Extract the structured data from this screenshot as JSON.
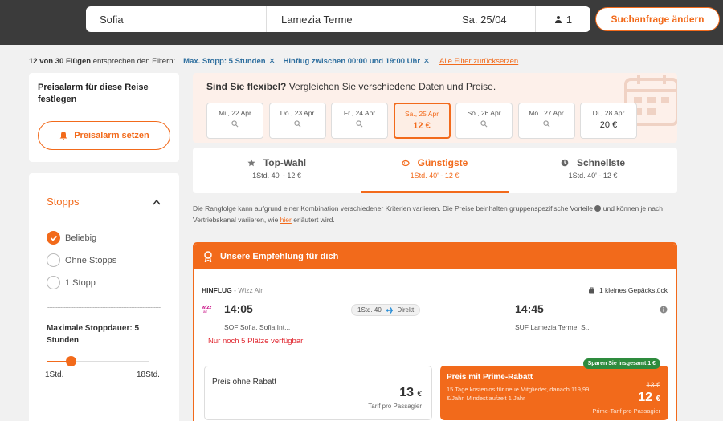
{
  "search": {
    "origin": "Sofia",
    "destination": "Lamezia Terme",
    "date": "Sa. 25/04",
    "passengers": "1",
    "change_label": "Suchanfrage ändern"
  },
  "filters": {
    "count_bold": "12 von 30 Flügen",
    "count_rest": " entsprechen den Filtern:",
    "chips": [
      "Max. Stopp: 5 Stunden",
      "Hinflug zwischen 00:00 und 19:00 Uhr"
    ],
    "chip_close": "✕",
    "reset_label": "Alle Filter zurücksetzen"
  },
  "alarm": {
    "title": "Preisalarm für diese Reise festlegen",
    "button": "Preisalarm setzen"
  },
  "stops": {
    "heading": "Stopps",
    "options": [
      {
        "label": "Beliebig",
        "checked": true
      },
      {
        "label": "Ohne Stopps",
        "checked": false
      },
      {
        "label": "1 Stopp",
        "checked": false
      }
    ],
    "max_duration_label": "Maximale Stoppdauer: 5 Stunden",
    "slider_min": "1Std.",
    "slider_max": "18Std.",
    "slider_value_fraction": 0.24
  },
  "flex": {
    "title_bold": "Sind Sie flexibel?",
    "title_rest": " Vergleichen Sie verschiedene Daten und Preise.",
    "dates": [
      {
        "label": "Mi., 22 Apr",
        "price": "",
        "selected": false
      },
      {
        "label": "Do., 23 Apr",
        "price": "",
        "selected": false
      },
      {
        "label": "Fr., 24 Apr",
        "price": "",
        "selected": false
      },
      {
        "label": "Sa., 25 Apr",
        "price": "12 €",
        "selected": true
      },
      {
        "label": "So., 26 Apr",
        "price": "",
        "selected": false
      },
      {
        "label": "Mo., 27 Apr",
        "price": "",
        "selected": false
      },
      {
        "label": "Di., 28 Apr",
        "price": "20 €",
        "selected": false
      }
    ]
  },
  "sort": {
    "tabs": [
      {
        "label": "Top-Wahl",
        "sub": "1Std. 40' - 12 €",
        "icon": "star-icon",
        "active": false
      },
      {
        "label": "Günstigste",
        "sub": "1Std. 40' - 12 €",
        "icon": "piggy-bank-icon",
        "active": true
      },
      {
        "label": "Schnellste",
        "sub": "1Std. 40' - 12 €",
        "icon": "clock-icon",
        "active": false
      }
    ]
  },
  "disclaimer": {
    "part1": "Die Rangfolge kann aufgrund einer Kombination verschiedener Kriterien variieren. Die Preise beinhalten gruppenspezifische Vorteile ",
    "part2": " und können je nach Vertriebskanal variieren, wie ",
    "link": "hier",
    "part3": " erläutert wird."
  },
  "recommendation": {
    "header": "Unsere Empfehlung für dich",
    "direction": "HINFLUG",
    "airline": " - Wizz Air",
    "baggage": "1 kleines Gepäckstück",
    "dep_time": "14:05",
    "arr_time": "14:45",
    "duration": "1Std. 40'",
    "stops_label": "Direkt",
    "dep_airport": "SOF Sofia, Sofia Int...",
    "arr_airport": "SUF Lamezia Terme, S...",
    "seats_left": "Nur noch 5 Plätze verfügbar!",
    "regular": {
      "label": "Preis ohne Rabatt",
      "price": "13",
      "currency": "€",
      "note": "Tarif pro Passagier"
    },
    "prime": {
      "badge": "Sparen Sie insgesamt 1 €",
      "title": "Preis mit Prime-Rabatt",
      "desc": "15 Tage kostenlos für neue Mitglieder, danach 119,99 €/Jahr, Mindestlaufzeit 1 Jahr",
      "old_price": "13 €",
      "price": "12",
      "currency": "€",
      "note": "Prime-Tarif pro Passagier"
    }
  },
  "colors": {
    "accent": "#f26a1b",
    "topbar": "#3b3b3b",
    "link_blue": "#2d6e9e",
    "warning_red": "#e0242d",
    "save_green": "#2e8b3d"
  }
}
